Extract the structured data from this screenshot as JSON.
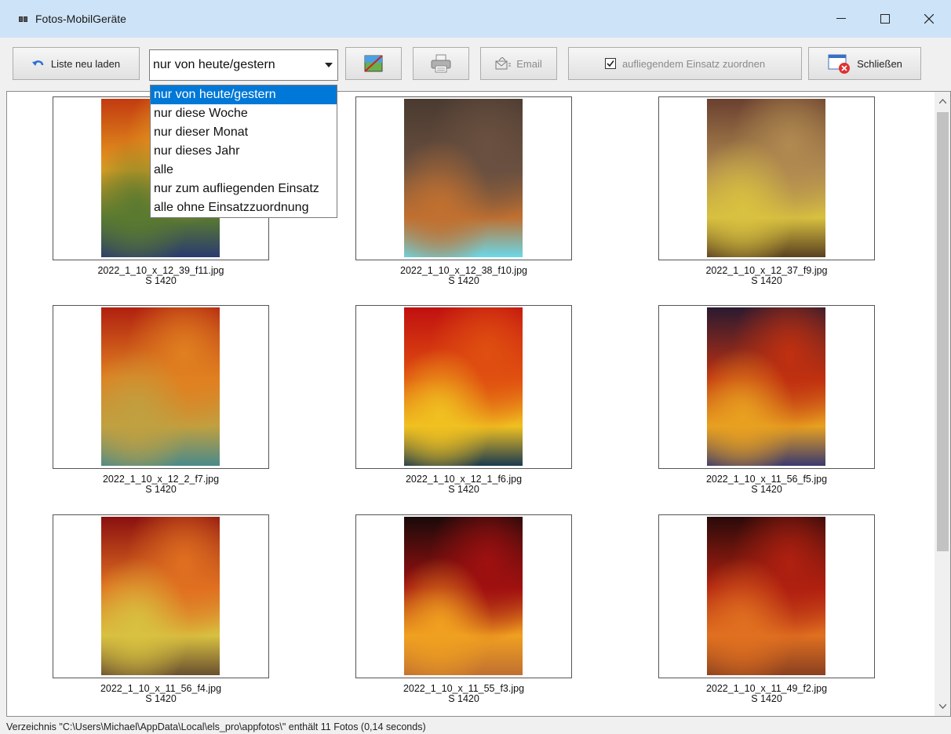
{
  "window": {
    "title": "Fotos-MobilGeräte",
    "minimize_label": "—",
    "maximize_label": "☐",
    "close_label": "✕"
  },
  "toolbar": {
    "reload_label": "Liste neu laden",
    "filter_value": "nur von heute/gestern",
    "email_label": "Email",
    "assign_label": "aufliegendem Einsatz zuordnen",
    "assign_checked": true,
    "close_label": "Schließen"
  },
  "dropdown": {
    "options": [
      "nur von heute/gestern",
      "nur diese Woche",
      "nur dieser Monat",
      "nur dieses Jahr",
      "alle",
      "nur zum aufliegenden Einsatz",
      "alle ohne Einsatzzuordnung"
    ],
    "selected_index": 0
  },
  "photos": [
    {
      "filename": "2022_1_10_x_12_39_f11.jpg",
      "unit": "S 1420",
      "colors": [
        "#c23a10",
        "#e7a020",
        "#5a7a30",
        "#2a3a70"
      ]
    },
    {
      "filename": "2022_1_10_x_12_38_f10.jpg",
      "unit": "S 1420",
      "colors": [
        "#4a3a30",
        "#6a5040",
        "#c07030",
        "#6ad8e8"
      ]
    },
    {
      "filename": "2022_1_10_x_12_37_f9.jpg",
      "unit": "S 1420",
      "colors": [
        "#6a4030",
        "#b08a50",
        "#d8c040",
        "#5a4020"
      ]
    },
    {
      "filename": "2022_1_10_x_12_2_f7.jpg",
      "unit": "S 1420",
      "colors": [
        "#b02010",
        "#e08020",
        "#c0a040",
        "#4a8a8a"
      ]
    },
    {
      "filename": "2022_1_10_x_12_1_f6.jpg",
      "unit": "S 1420",
      "colors": [
        "#c01010",
        "#e05010",
        "#f0c020",
        "#1a3a50"
      ]
    },
    {
      "filename": "2022_1_10_x_11_56_f5.jpg",
      "unit": "S 1420",
      "colors": [
        "#2a1a30",
        "#c03010",
        "#e8a020",
        "#3a3a70"
      ]
    },
    {
      "filename": "2022_1_10_x_11_56_f4.jpg",
      "unit": "S 1420",
      "colors": [
        "#8a1010",
        "#e07020",
        "#d8c040",
        "#6a5030"
      ]
    },
    {
      "filename": "2022_1_10_x_11_55_f3.jpg",
      "unit": "S 1420",
      "colors": [
        "#1a0a0a",
        "#a01010",
        "#f0a020",
        "#c07030"
      ]
    },
    {
      "filename": "2022_1_10_x_11_49_f2.jpg",
      "unit": "S 1420",
      "colors": [
        "#2a0a0a",
        "#b02010",
        "#e07020",
        "#8a4020"
      ]
    }
  ],
  "status": {
    "text": "Verzeichnis \"C:\\Users\\Michael\\AppData\\Local\\els_pro\\appfotos\\\" enthält 11 Fotos (0,14 seconds)"
  }
}
